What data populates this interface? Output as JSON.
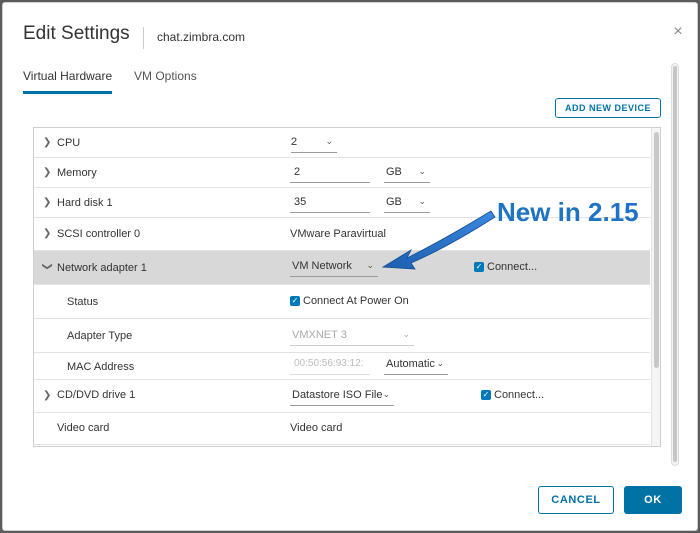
{
  "dialog": {
    "title": "Edit Settings",
    "subtitle": "chat.zimbra.com",
    "close_icon": "×"
  },
  "tabs": [
    {
      "label": "Virtual Hardware",
      "active": true
    },
    {
      "label": "VM Options",
      "active": false
    }
  ],
  "toolbar": {
    "add_device_label": "ADD NEW DEVICE"
  },
  "hardware": {
    "cpu": {
      "label": "CPU",
      "value": "2"
    },
    "memory": {
      "label": "Memory",
      "value": "2",
      "unit": "GB"
    },
    "disk": {
      "label": "Hard disk 1",
      "value": "35",
      "unit": "GB"
    },
    "scsi": {
      "label": "SCSI controller 0",
      "value": "VMware Paravirtual"
    },
    "network": {
      "label": "Network adapter 1",
      "value": "VM Network",
      "connect_label": "Connect...",
      "status_label": "Status",
      "status_value": "Connect At Power On",
      "adapter_type_label": "Adapter Type",
      "adapter_type_value": "VMXNET 3",
      "mac_label": "MAC Address",
      "mac_value": "00:50:56:93:12:",
      "mac_mode": "Automatic"
    },
    "cddvd": {
      "label": "CD/DVD drive 1",
      "value": "Datastore ISO File",
      "connect_label": "Connect..."
    },
    "video": {
      "label": "Video card",
      "value": "Video card"
    }
  },
  "callout": {
    "text": "New in 2.15",
    "color": "#1e73c4"
  },
  "footer": {
    "cancel_label": "CANCEL",
    "ok_label": "OK"
  },
  "colors": {
    "accent": "#0072a3",
    "selected_row": "#d8d8d8",
    "checkbox": "#0079b8"
  }
}
